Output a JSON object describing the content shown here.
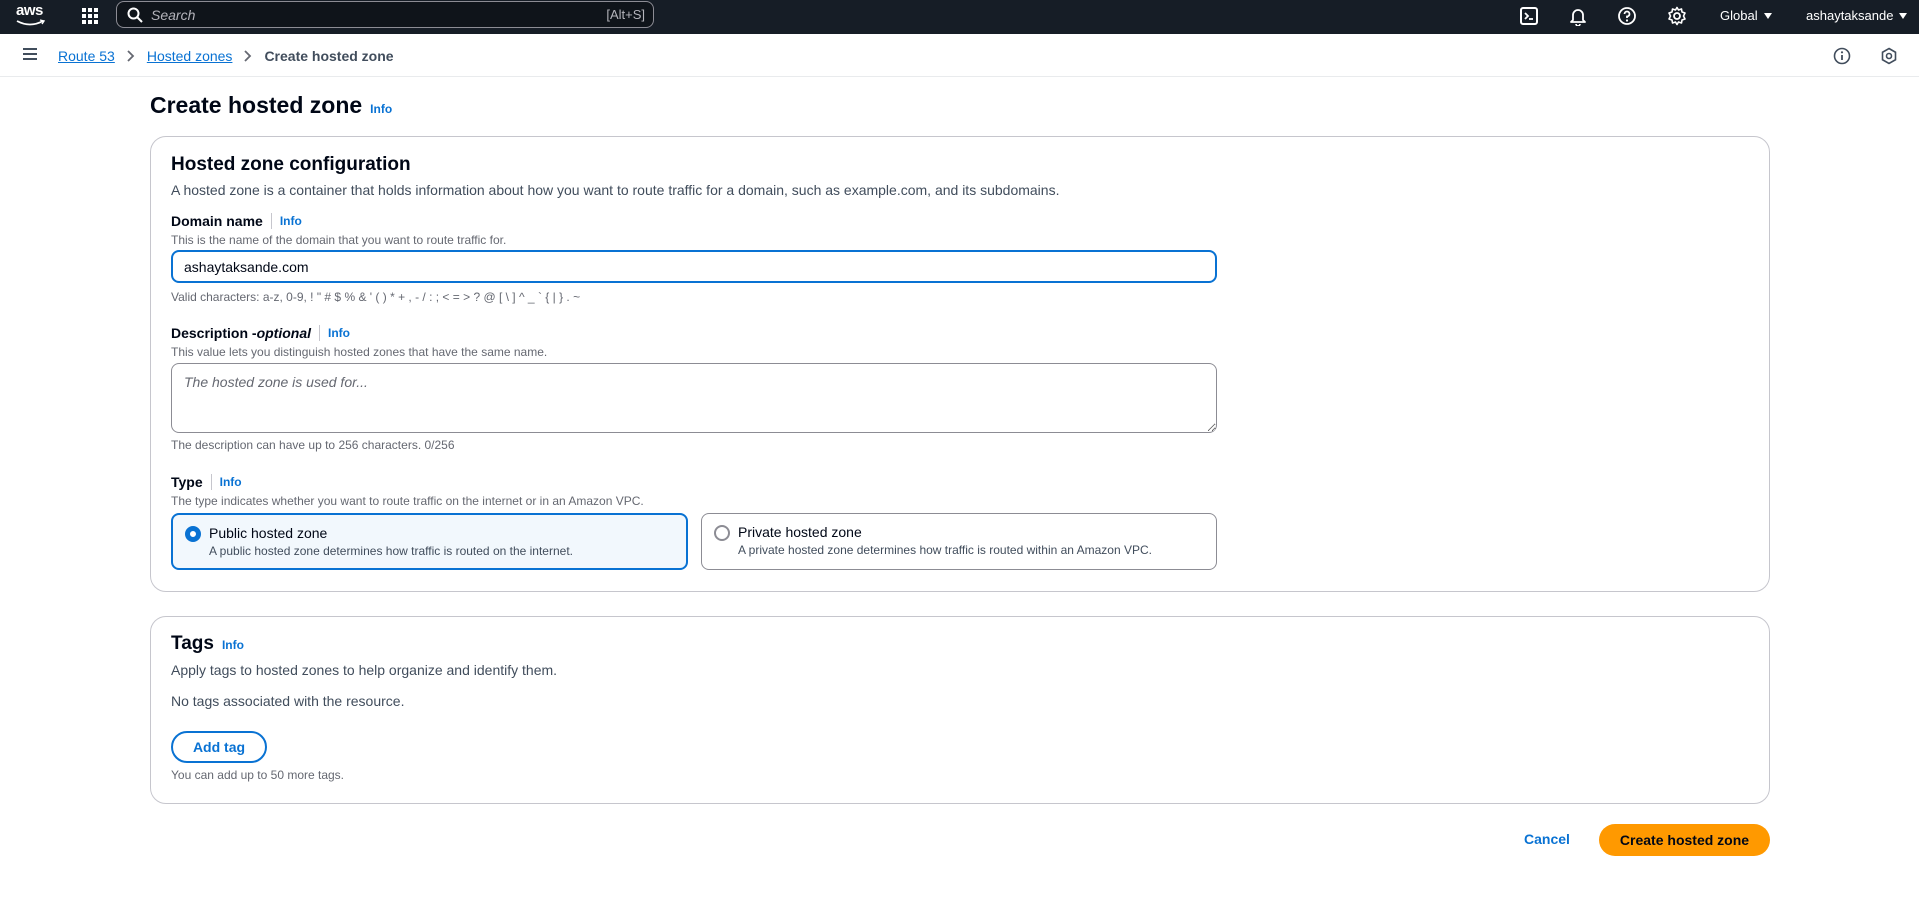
{
  "topnav": {
    "logo_text": "aws",
    "search": {
      "placeholder": "Search",
      "shortcut": "[Alt+S]"
    },
    "region": "Global",
    "account": "ashaytaksande",
    "icons": [
      "cloudshell-icon",
      "bell-icon",
      "help-icon",
      "gear-icon"
    ]
  },
  "breadcrumb": {
    "items": [
      "Route 53",
      "Hosted zones"
    ],
    "current": "Create hosted zone"
  },
  "page": {
    "title": "Create hosted zone",
    "info": "Info"
  },
  "config": {
    "title": "Hosted zone configuration",
    "description": "A hosted zone is a container that holds information about how you want to route traffic for a domain, such as example.com, and its subdomains.",
    "domain": {
      "label": "Domain name",
      "info": "Info",
      "help": "This is the name of the domain that you want to route traffic for.",
      "value": "ashaytaksande.com",
      "constraint": "Valid characters: a-z, 0-9, ! \" # $ % & ' ( ) * + , - / : ; < = > ? @ [ \\ ] ^ _ ` { | } . ~"
    },
    "description_field": {
      "label": "Description - ",
      "label_optional": "optional",
      "info": "Info",
      "help": "This value lets you distinguish hosted zones that have the same name.",
      "placeholder": "The hosted zone is used for...",
      "constraint": "The description can have up to 256 characters. 0/256"
    },
    "type": {
      "label": "Type",
      "info": "Info",
      "help": "The type indicates whether you want to route traffic on the internet or in an Amazon VPC.",
      "options": [
        {
          "title": "Public hosted zone",
          "desc": "A public hosted zone determines how traffic is routed on the internet.",
          "selected": true
        },
        {
          "title": "Private hosted zone",
          "desc": "A private hosted zone determines how traffic is routed within an Amazon VPC.",
          "selected": false
        }
      ]
    }
  },
  "tags": {
    "title": "Tags",
    "info": "Info",
    "description": "Apply tags to hosted zones to help organize and identify them.",
    "empty": "No tags associated with the resource.",
    "add_label": "Add tag",
    "limit": "You can add up to 50 more tags."
  },
  "actions": {
    "cancel": "Cancel",
    "create": "Create hosted zone"
  },
  "colors": {
    "nav_bg": "#161d26",
    "link": "#0972d3",
    "primary": "#ff9900"
  }
}
